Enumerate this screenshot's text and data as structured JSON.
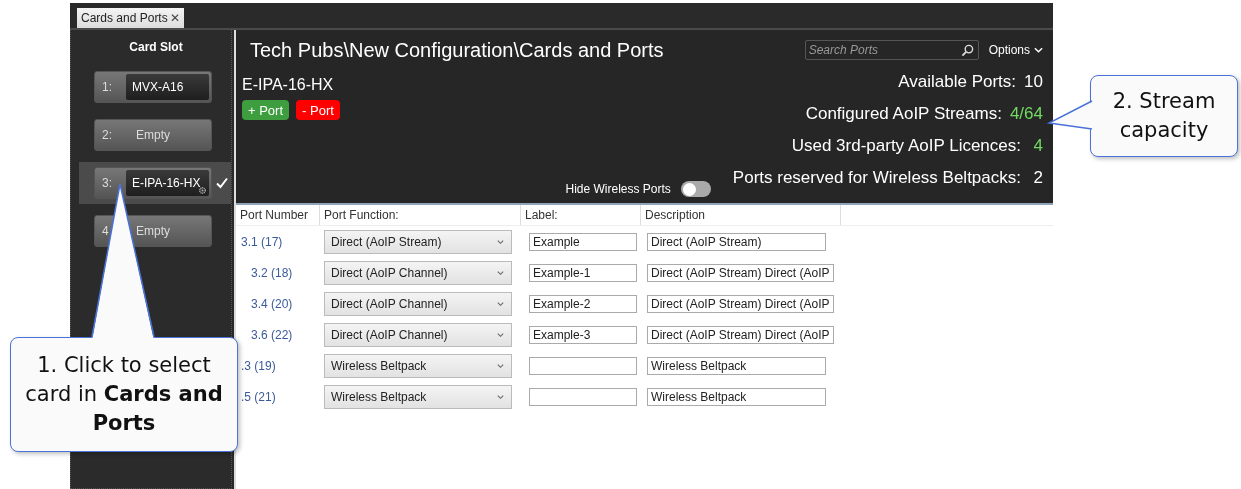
{
  "tab": {
    "label": "Cards and Ports",
    "close": "✕"
  },
  "sidebar": {
    "heading": "Card Slot",
    "slots": [
      {
        "number": "1:",
        "name": "MVX-A16",
        "kind": "card",
        "selected": false
      },
      {
        "number": "2:",
        "name": "Empty",
        "kind": "empty",
        "selected": false
      },
      {
        "number": "3:",
        "name": "E-IPA-16-HX",
        "kind": "card",
        "selected": true
      },
      {
        "number": "4",
        "name": "Empty",
        "kind": "empty",
        "selected": false
      }
    ]
  },
  "header": {
    "title": "Tech Pubs\\New Configuration\\Cards and Ports",
    "search": {
      "placeholder": "Search Ports"
    },
    "options": "Options"
  },
  "card": {
    "name": "E-IPA-16-HX",
    "buttons": [
      {
        "label": "+ Port",
        "kind": "add"
      },
      {
        "label": "- Port",
        "kind": "remove"
      }
    ]
  },
  "hide_wireless": {
    "label": "Hide Wireless Ports",
    "on": false
  },
  "stats": [
    {
      "label": "Available Ports:",
      "value": "10",
      "highlight": false
    },
    {
      "label": "Configured AoIP Streams:",
      "value": "4/64",
      "highlight": true
    },
    {
      "label": "Used 3rd-party AoIP Licences:",
      "value": "4",
      "highlight": true
    },
    {
      "label": "Ports reserved for Wireless Beltpacks:",
      "value": "2",
      "highlight": false
    }
  ],
  "table": {
    "columns": [
      "Port Number",
      "Port Function:",
      "Label:",
      "Description"
    ],
    "rows": [
      {
        "port": "3.1 (17)",
        "function": "Direct (AoIP Stream)",
        "label": "Example",
        "description": "Direct (AoIP Stream)",
        "children": [
          {
            "port": "3.2 (18)",
            "function": "Direct (AoIP Channel)",
            "label": "Example-1",
            "description": "Direct (AoIP Stream) Direct (AoIP"
          },
          {
            "port": "3.4 (20)",
            "function": "Direct (AoIP Channel)",
            "label": "Example-2",
            "description": "Direct (AoIP Stream) Direct (AoIP"
          },
          {
            "port": "3.6 (22)",
            "function": "Direct (AoIP Channel)",
            "label": "Example-3",
            "description": "Direct (AoIP Stream) Direct (AoIP"
          }
        ]
      },
      {
        "port": ".3 (19)",
        "function": "Wireless Beltpack",
        "description": "Wireless Beltpack"
      },
      {
        "port": ".5 (21)",
        "function": "Wireless Beltpack",
        "description": "Wireless Beltpack"
      }
    ]
  },
  "callouts": [
    {
      "text": "1. Click to select card in **Cards and Ports**",
      "kind": "left"
    },
    {
      "text": "2. Stream capacity",
      "kind": "right"
    }
  ]
}
